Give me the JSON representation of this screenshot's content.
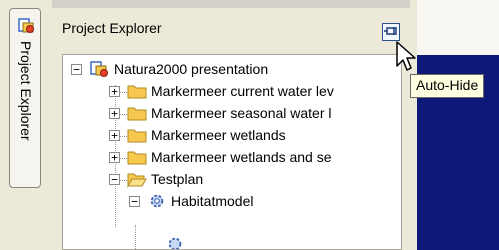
{
  "side_tab": {
    "label": "Project Explorer",
    "icon": "project-icon"
  },
  "panel": {
    "title": "Project Explorer",
    "autohide_icon": "pin-icon"
  },
  "tooltip": {
    "text": "Auto-Hide"
  },
  "tree": {
    "root": {
      "label": "Natura2000 presentation",
      "toggle": "−",
      "icon": "project-icon"
    },
    "items": [
      {
        "label": "Markermeer current water lev",
        "toggle": "+",
        "icon": "folder-icon"
      },
      {
        "label": "Markermeer seasonal water l",
        "toggle": "+",
        "icon": "folder-icon"
      },
      {
        "label": "Markermeer wetlands",
        "toggle": "+",
        "icon": "folder-icon"
      },
      {
        "label": "Markermeer wetlands and se",
        "toggle": "+",
        "icon": "folder-icon"
      },
      {
        "label": "Testplan",
        "toggle": "−",
        "icon": "folder-icon"
      }
    ],
    "child": {
      "label": "Habitatmodel",
      "toggle": "−",
      "icon": "gear-icon"
    }
  },
  "colors": {
    "folder": "#f6c94e",
    "background_blue": "#0e1877",
    "tooltip_bg": "#fffee1"
  }
}
